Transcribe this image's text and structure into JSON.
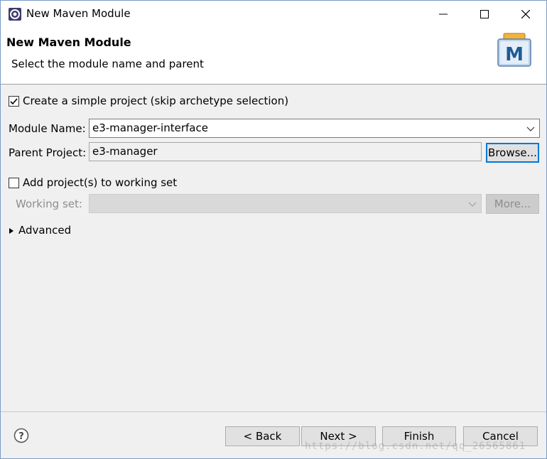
{
  "window": {
    "title": "New Maven Module"
  },
  "header": {
    "title": "New Maven Module",
    "subtitle": "Select the module name and parent",
    "logo_letter": "M"
  },
  "form": {
    "simple_project": {
      "label": "Create a simple project (skip archetype selection)",
      "checked": true
    },
    "module_name": {
      "label": "Module Name:",
      "value": "e3-manager-interface"
    },
    "parent_project": {
      "label": "Parent Project:",
      "value": "e3-manager",
      "browse_label": "Browse..."
    },
    "working_set_toggle": {
      "label": "Add project(s) to working set",
      "checked": false
    },
    "working_set": {
      "label": "Working set:",
      "value": "",
      "more_label": "More..."
    },
    "advanced": {
      "label": "Advanced"
    }
  },
  "footer": {
    "back_label": "< Back",
    "next_label": "Next >",
    "finish_label": "Finish",
    "cancel_label": "Cancel",
    "watermark": "https://blog.csdn.net/qq_26565861"
  },
  "colors": {
    "focus_border": "#0078d7",
    "disabled_text": "#8d8d8d"
  }
}
